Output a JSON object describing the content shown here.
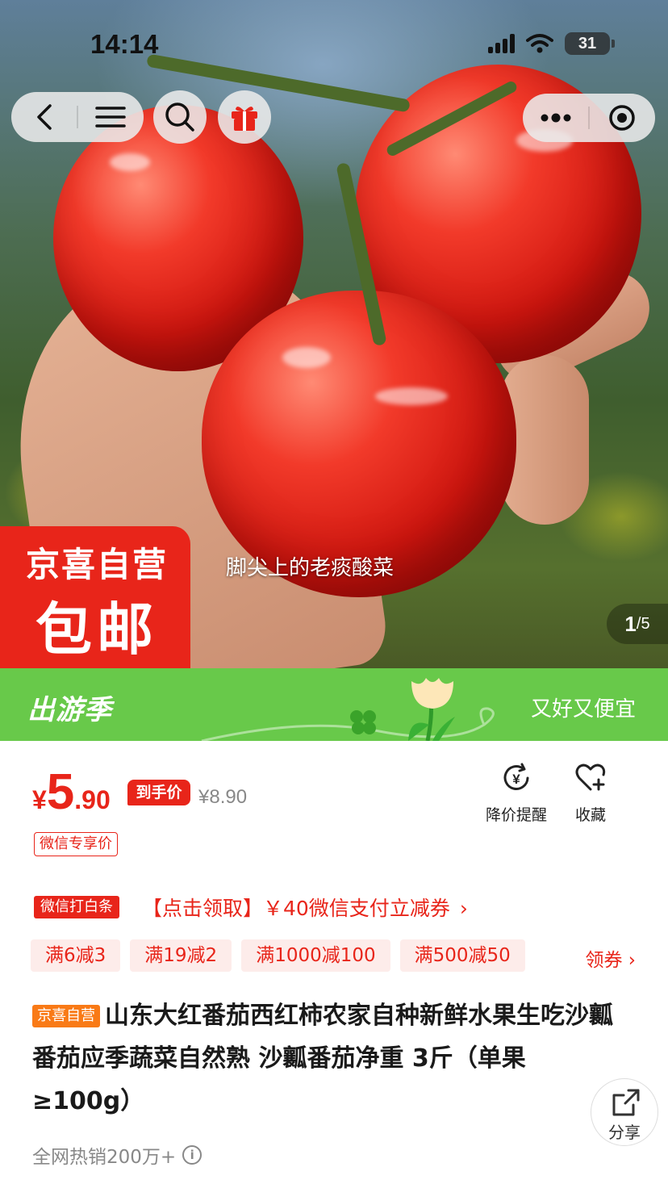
{
  "status": {
    "time": "14:14",
    "battery": "31"
  },
  "hero": {
    "caption": "脚尖上的老痰酸菜",
    "badge_line1": "京喜自营",
    "badge_line2": "包邮",
    "counter_current": "1",
    "counter_total": "/5"
  },
  "banner": {
    "left": "出游季",
    "right": "又好又便宜"
  },
  "price": {
    "currency": "¥",
    "integer": "5",
    "decimal": ".90",
    "daoshou_label": "到手价",
    "original": "¥8.90",
    "wechat_exclusive": "微信专享价"
  },
  "actions": {
    "price_alert": "降价提醒",
    "favorite": "收藏"
  },
  "promo": {
    "baitiao_tag": "微信打白条",
    "coupon_text": "【点击领取】￥40微信支付立减券",
    "coupon_chevron": "›",
    "chips": [
      "满6减3",
      "满19减2",
      "满1000减100",
      "满500减50"
    ],
    "get_coupon": "领券 ›"
  },
  "product": {
    "tag": "京喜自营",
    "title": "山东大红番茄西红柿农家自种新鲜水果生吃沙瓤番茄应季蔬菜自然熟 沙瓤番茄净重 3斤（单果≥100g）",
    "sales": "全网热销200万+",
    "share_label": "分享"
  },
  "colors": {
    "accent": "#e8251a",
    "green": "#68c94a",
    "tag_orange": "#f97a16"
  }
}
